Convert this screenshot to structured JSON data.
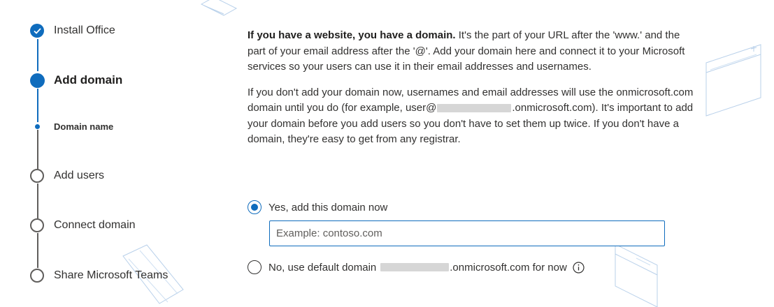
{
  "stepper": {
    "steps": [
      {
        "label": "Install Office",
        "state": "done",
        "marker_icon": "checkmark-icon"
      },
      {
        "label": "Add domain",
        "state": "current"
      },
      {
        "label": "Domain name",
        "state": "sub"
      },
      {
        "label": "Add users",
        "state": "pending"
      },
      {
        "label": "Connect domain",
        "state": "pending"
      },
      {
        "label": "Share Microsoft Teams",
        "state": "pending"
      }
    ]
  },
  "content": {
    "intro_bold": "If you have a website, you have a domain.",
    "intro_rest": " It's the part of your URL after the 'www.' and the part of your email address after the '@'. Add your domain here and connect it to your Microsoft services so your users can use it in their email addresses and usernames.",
    "default_before": "If you don't add your domain now, usernames and email addresses will use the onmicrosoft.com domain until you do (for example, user@",
    "default_after": ".onmicrosoft.com). It's important to add your domain before you add users so you don't have to set them up twice. If you don't have a domain, they're easy to get from any registrar."
  },
  "options": {
    "add_now_label": "Yes, add this domain now",
    "add_now_checked": true,
    "domain_input_placeholder": "Example: contoso.com",
    "domain_input_value": "",
    "use_default_prefix": "No, use default domain",
    "use_default_suffix": ".onmicrosoft.com for now",
    "use_default_checked": false,
    "info_icon": "info-icon"
  },
  "colors": {
    "accent": "#0f6cbd",
    "text": "#323130",
    "redaction": "#d6d6d6"
  }
}
